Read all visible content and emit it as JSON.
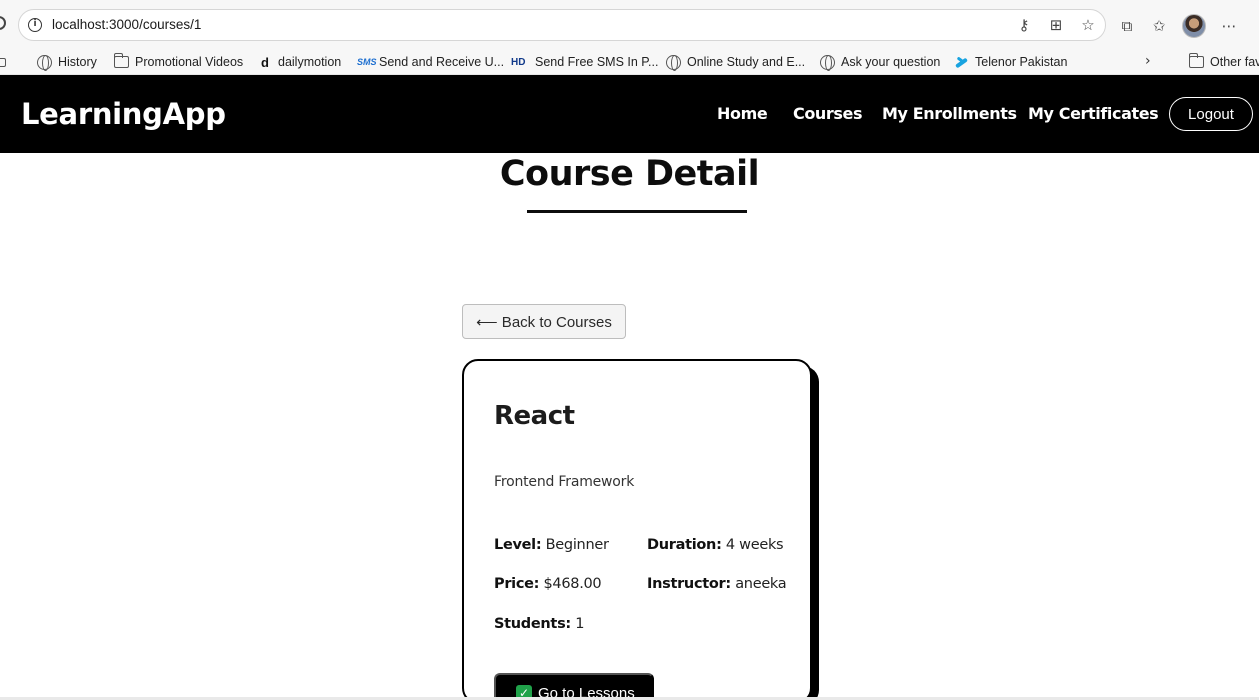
{
  "browser": {
    "url": "localhost:3000/courses/1",
    "bookmarks": [
      {
        "label": "History",
        "icon": "globe-icon"
      },
      {
        "label": "Promotional Videos",
        "icon": "folder-icon"
      },
      {
        "label": "dailymotion",
        "icon": "dailymotion-icon"
      },
      {
        "label": "Send and Receive U...",
        "icon": "sms-icon"
      },
      {
        "label": "Send Free SMS In P...",
        "icon": "hd-icon"
      },
      {
        "label": "Online Study and E...",
        "icon": "globe-icon"
      },
      {
        "label": "Ask your question",
        "icon": "globe-icon"
      },
      {
        "label": "Telenor Pakistan",
        "icon": "telenor-icon"
      }
    ],
    "other_favorites": "Other fav"
  },
  "nav": {
    "brand": "LearningApp",
    "links": [
      "Home",
      "Courses",
      "My Enrollments",
      "My Certificates"
    ],
    "logout": "Logout"
  },
  "page": {
    "title": "Course Detail",
    "back_label": "⟵ Back to Courses"
  },
  "course": {
    "name": "React",
    "description": "Frontend Framework",
    "level_label": "Level:",
    "level": "Beginner",
    "duration_label": "Duration:",
    "duration": "4 weeks",
    "price_label": "Price:",
    "price": "$468.00",
    "instructor_label": "Instructor:",
    "instructor": "aneeka",
    "students_label": "Students:",
    "students": "1",
    "action_label": "Go to Lessons"
  },
  "colors": {
    "nav_bg": "#000000",
    "nav_text": "#ffffff",
    "check_green": "#20a24a"
  }
}
